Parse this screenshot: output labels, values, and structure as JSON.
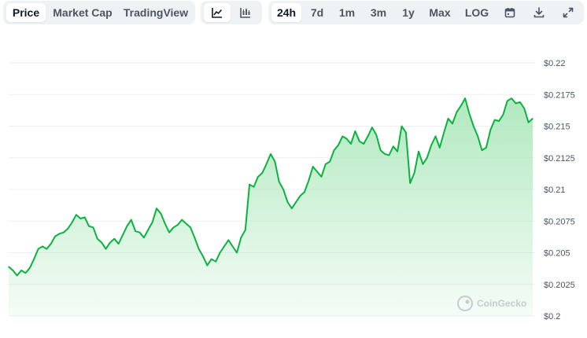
{
  "toolbar": {
    "view_tabs": [
      {
        "label": "Price",
        "active": true
      },
      {
        "label": "Market Cap",
        "active": false
      },
      {
        "label": "TradingView",
        "active": false
      }
    ],
    "chart_type_icons": [
      {
        "icon": "line-chart-icon",
        "active": true
      },
      {
        "icon": "candlestick-chart-icon",
        "active": false
      }
    ],
    "ranges": [
      {
        "label": "24h",
        "active": true
      },
      {
        "label": "7d",
        "active": false
      },
      {
        "label": "1m",
        "active": false
      },
      {
        "label": "3m",
        "active": false
      },
      {
        "label": "1y",
        "active": false
      },
      {
        "label": "Max",
        "active": false
      },
      {
        "label": "LOG",
        "active": false
      }
    ],
    "tool_icons": [
      "calendar-icon",
      "download-icon",
      "expand-icon"
    ]
  },
  "watermark": "CoinGecko",
  "colors": {
    "line": "#16c784",
    "line_stroke": "#0ab23e",
    "fill_top": "#a8e6b8",
    "grid": "#eceff2",
    "active_bg": "#ffffff",
    "toolbar_bg": "#eff2f5"
  },
  "chart_data": {
    "type": "area",
    "title": "",
    "xlabel": "",
    "ylabel": "",
    "ylim": [
      0.2,
      0.22
    ],
    "yticks": [
      0.2,
      0.2025,
      0.205,
      0.2075,
      0.21,
      0.2125,
      0.215,
      0.2175,
      0.22
    ],
    "ytick_labels": [
      "$0.2",
      "$0.2025",
      "$0.205",
      "$0.2075",
      "$0.21",
      "$0.2125",
      "$0.215",
      "$0.2175",
      "$0.22"
    ],
    "grid": true,
    "legend": "none",
    "series": [
      {
        "values": [
          0.2039,
          0.2036,
          0.2032,
          0.2036,
          0.2034,
          0.2038,
          0.2045,
          0.2053,
          0.2055,
          0.2053,
          0.2057,
          0.2063,
          0.2065,
          0.2066,
          0.2069,
          0.2074,
          0.208,
          0.2077,
          0.2078,
          0.2071,
          0.207,
          0.2061,
          0.2058,
          0.2053,
          0.2058,
          0.2061,
          0.2057,
          0.2064,
          0.2071,
          0.2076,
          0.2067,
          0.2066,
          0.2062,
          0.2068,
          0.2074,
          0.2085,
          0.2081,
          0.2073,
          0.2066,
          0.207,
          0.2072,
          0.2076,
          0.2073,
          0.207,
          0.2062,
          0.2053,
          0.2047,
          0.204,
          0.2045,
          0.2043,
          0.205,
          0.2055,
          0.206,
          0.2055,
          0.205,
          0.2062,
          0.2068,
          0.2104,
          0.2102,
          0.211,
          0.2113,
          0.212,
          0.2128,
          0.2122,
          0.2106,
          0.21,
          0.209,
          0.2085,
          0.209,
          0.2095,
          0.2098,
          0.2107,
          0.2118,
          0.2114,
          0.211,
          0.212,
          0.2122,
          0.2131,
          0.2135,
          0.2142,
          0.214,
          0.2136,
          0.2146,
          0.2138,
          0.2136,
          0.2142,
          0.2149,
          0.2143,
          0.2131,
          0.2128,
          0.2127,
          0.2134,
          0.213,
          0.215,
          0.2145,
          0.2105,
          0.2113,
          0.213,
          0.212,
          0.2125,
          0.2135,
          0.2142,
          0.2133,
          0.2145,
          0.2156,
          0.2152,
          0.2161,
          0.2166,
          0.2172,
          0.216,
          0.215,
          0.2142,
          0.2131,
          0.2133,
          0.2147,
          0.2155,
          0.2154,
          0.2159,
          0.217,
          0.2172,
          0.2168,
          0.2169,
          0.2164,
          0.2153,
          0.2156
        ]
      }
    ]
  }
}
